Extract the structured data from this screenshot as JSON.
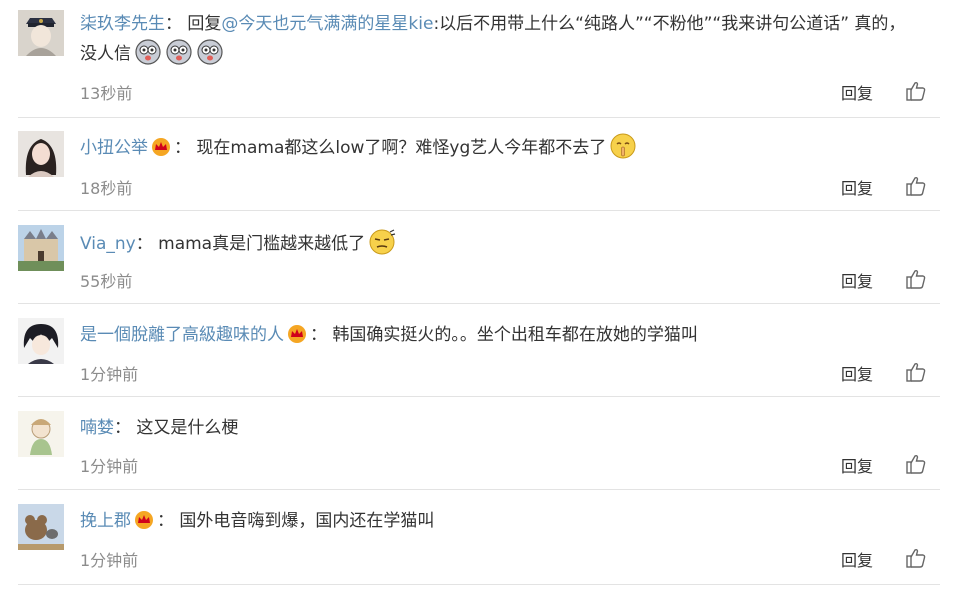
{
  "actions": {
    "reply_label": "回复"
  },
  "comments": [
    {
      "user": "柒玖李先生",
      "colon": "：",
      "text_l1": " 回复",
      "mention": "@今天也元气满满的星星kie",
      "text_l1b": ":以后不用带上什么“纯路人”“不粉他”“我来讲句公道话” 真的，",
      "text_l2": "没人信",
      "time": "13秒前"
    },
    {
      "user": "小扭公举",
      "colon": "：",
      "text": " 现在mama都这么low了啊？难怪yg艺人今年都不去了",
      "time": "18秒前"
    },
    {
      "user": "Via_ny",
      "colon": "：",
      "text": " mama真是门槛越来越低了",
      "time": "55秒前"
    },
    {
      "user": "是一個脫離了高級趣味的人",
      "colon": "：",
      "text": " 韩国确实挺火的。。坐个出租车都在放她的学猫叫",
      "time": "1分钟前"
    },
    {
      "user": "喃婪",
      "colon": "：",
      "text": " 这又是什么梗",
      "time": "1分钟前"
    },
    {
      "user": "挽上郡",
      "colon": "：",
      "text": " 国外电音嗨到爆，国内还在学猫叫",
      "time": "1分钟前"
    }
  ]
}
